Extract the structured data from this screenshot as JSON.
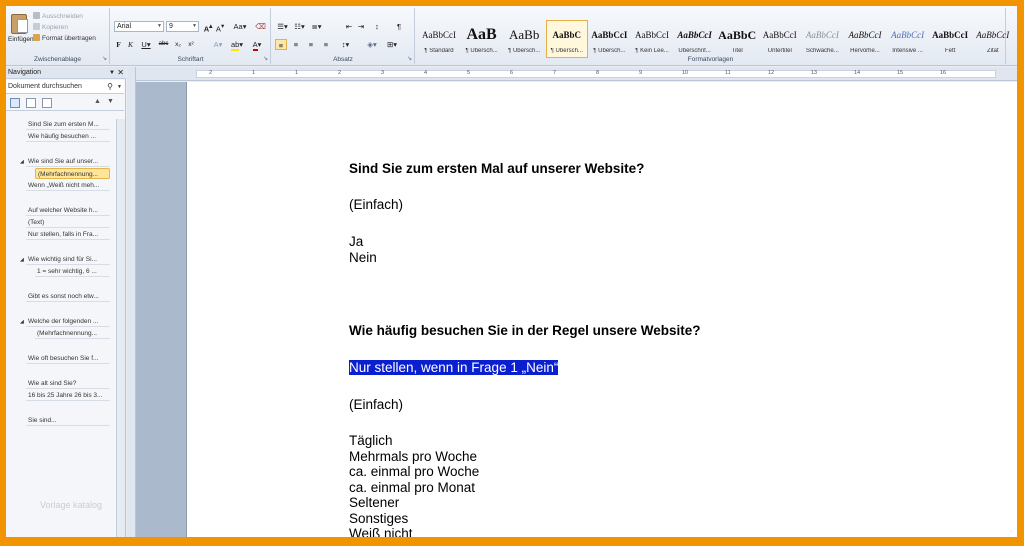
{
  "clipboard": {
    "paste_label": "Einfügen",
    "cut_label": "Ausschneiden",
    "copy_label": "Kopieren",
    "format_painter_label": "Format übertragen",
    "group_title": "Zwischenablage"
  },
  "font": {
    "name": "Arial",
    "size": "9",
    "group_title": "Schriftart"
  },
  "paragraph": {
    "group_title": "Absatz"
  },
  "styles": {
    "group_title": "Formatvorlagen",
    "items": [
      {
        "preview": "AaBbCcI",
        "name": "¶ Standard"
      },
      {
        "preview": "AaB",
        "name": "¶ Übersch..."
      },
      {
        "preview": "AaBb",
        "name": "¶ Übersch..."
      },
      {
        "preview": "AaBbC",
        "name": "¶ Übersch...",
        "active": true
      },
      {
        "preview": "AaBbCcI",
        "name": "¶ Übersch..."
      },
      {
        "preview": "AaBbCcI",
        "name": "¶ Kein Lee..."
      },
      {
        "preview": "AaBbCcI",
        "name": "Überschrif..."
      },
      {
        "preview": "AaBbC",
        "name": "Titel"
      },
      {
        "preview": "AaBbCcI",
        "name": "Untertitel"
      },
      {
        "preview": "AaBbCcI",
        "name": "Schwache..."
      },
      {
        "preview": "AaBbCcI",
        "name": "Hervorhe..."
      },
      {
        "preview": "AaBbCcI",
        "name": "Intensive ..."
      },
      {
        "preview": "AaBbCcI",
        "name": "Fett"
      },
      {
        "preview": "AaBbCcI",
        "name": "Zitat"
      }
    ]
  },
  "nav": {
    "title": "Navigation",
    "search_placeholder": "Dokument durchsuchen",
    "items": [
      {
        "label": "Sind Sie zum ersten M...",
        "level": 1
      },
      {
        "label": "Wie häufig besuchen ...",
        "level": 1
      },
      {
        "label": "Wie sind Sie auf unser...",
        "level": 1,
        "expanded": true
      },
      {
        "label": "(Mehrfachnennung...",
        "level": 2,
        "selected": true
      },
      {
        "label": "Wenn „Weiß nicht meh...",
        "level": 1
      },
      {
        "label": "Auf welcher Website h...",
        "level": 1
      },
      {
        "label": "(Text)",
        "level": 1
      },
      {
        "label": "Nur stellen, falls in Fra...",
        "level": 1
      },
      {
        "label": "Wie wichtig sind für Si...",
        "level": 1,
        "expanded": true
      },
      {
        "label": "1 = sehr wichtig, 6 ...",
        "level": 2
      },
      {
        "label": "Gibt es sonst noch etw...",
        "level": 1
      },
      {
        "label": "Welche der folgenden ...",
        "level": 1,
        "expanded": true
      },
      {
        "label": "(Mehrfachnennung...",
        "level": 2
      },
      {
        "label": "Wie oft besuchen Sie f...",
        "level": 1
      },
      {
        "label": "Wie alt sind Sie?",
        "level": 1
      },
      {
        "label": "16 bis 25 Jahre 26 bis 3...",
        "level": 1
      },
      {
        "label": "Sie sind...",
        "level": 1
      }
    ]
  },
  "watermark": "Vorlage katalog",
  "document": {
    "q1": "Sind Sie zum ersten Mal auf unserer Website?",
    "q1_type": "(Einfach)",
    "q1_opt1": " Ja",
    "q1_opt2": " Nein",
    "q2": "Wie häufig besuchen Sie in der Regel unsere Website?",
    "q2_note": "Nur stellen, wenn  in Frage 1 „Nein“",
    "q2_type": " (Einfach)",
    "q2_options": [
      "Täglich",
      "Mehrmals pro Woche",
      "ca. einmal pro Woche",
      "ca. einmal pro Monat",
      "Seltener",
      "Sonstiges",
      "Weiß nicht"
    ]
  },
  "ruler_numbers": [
    "2",
    "1",
    "1",
    "2",
    "3",
    "4",
    "5",
    "6",
    "7",
    "8",
    "9",
    "10",
    "11",
    "12",
    "13",
    "14",
    "15",
    "16"
  ],
  "colors": {
    "accent": "#f29400",
    "highlight": "#0a1fd0"
  }
}
